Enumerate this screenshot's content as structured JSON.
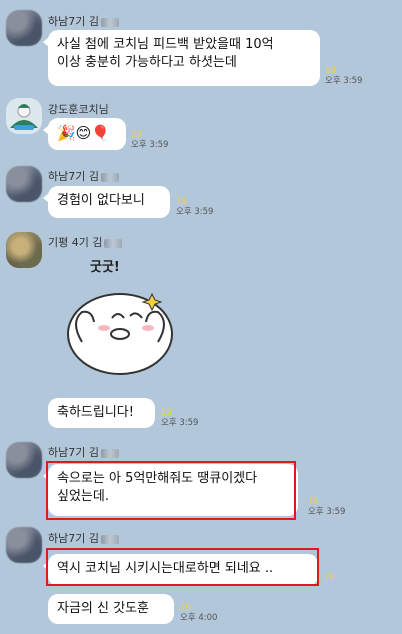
{
  "messages": [
    {
      "sender": "하남7기 김",
      "text_line1": "사실 첨에 코치님 피드백 받았을때 10억",
      "text_line2": "이상 충분히 가능하다고 하셧는데",
      "unread": "19",
      "time": "오후 3:59"
    },
    {
      "sender": "강도훈코치님",
      "emojis": "🎉😊🎈",
      "unread": "19",
      "time": "오후 3:59"
    },
    {
      "sender": "하남7기 김",
      "text": "경험이 없다보니",
      "unread": "19",
      "time": "오후 3:59"
    },
    {
      "sender": "기평 4기 김",
      "sticker_text": "굿굿!",
      "text": "축하드립니다!",
      "unread": "19",
      "time": "오후 3:59"
    },
    {
      "sender": "하남7기 김",
      "text_line1": "속으로는 아 5억만해줘도 땡큐이겠다",
      "text_line2": "싶었는데.",
      "unread": "19",
      "time": "오후 3:59"
    },
    {
      "sender": "하남7기 김",
      "text": "역시 코치님 시키시는대로하면 되네요 ..",
      "unread": "19"
    },
    {
      "text": "자금의 신 갓도훈",
      "unread": "19",
      "time": "오후 4:00"
    }
  ],
  "colors": {
    "background": "#b2c7d9",
    "bubble": "#ffffff",
    "highlight": "#e0191b",
    "unread": "#f4d03f"
  }
}
